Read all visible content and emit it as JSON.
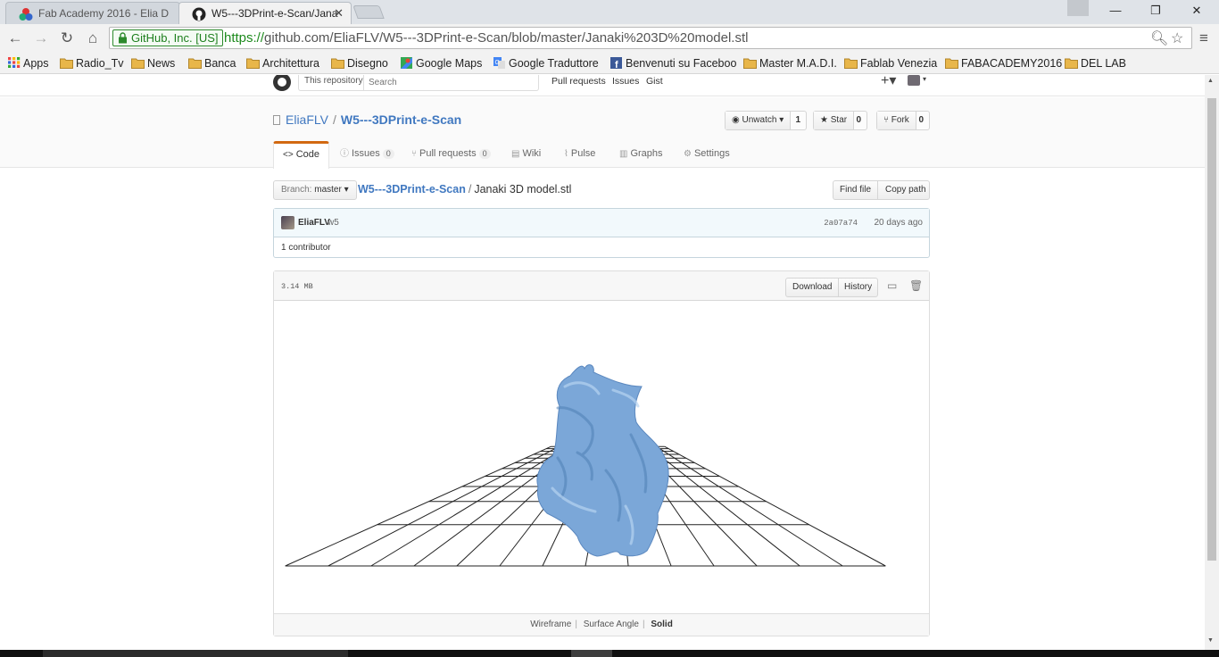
{
  "browser": {
    "tabs": [
      {
        "title": "Fab Academy 2016 - Elia D",
        "active": false,
        "favicon": "fab-academy-icon"
      },
      {
        "title": "W5---3DPrint-e-Scan/Jana",
        "active": true,
        "favicon": "github-icon"
      }
    ],
    "window_controls": {
      "minimize": "—",
      "restore": "❐",
      "close": "✕"
    },
    "address": {
      "ev_label": "GitHub, Inc. [US]",
      "scheme": "https://",
      "host_path": "github.com/EliaFLV/W5---3DPrint-e-Scan/blob/master/Janaki%203D%20model.stl"
    },
    "bookmarks": [
      {
        "label": "Apps",
        "icon": "apps-grid-icon"
      },
      {
        "label": "Radio_Tv",
        "icon": "folder-icon"
      },
      {
        "label": "News",
        "icon": "folder-icon"
      },
      {
        "label": "Banca",
        "icon": "folder-icon"
      },
      {
        "label": "Architettura",
        "icon": "folder-icon"
      },
      {
        "label": "Disegno",
        "icon": "folder-icon"
      },
      {
        "label": "Google Maps",
        "icon": "google-maps-icon"
      },
      {
        "label": "Google Traduttore",
        "icon": "google-translate-icon"
      },
      {
        "label": "Benvenuti su Faceboo",
        "icon": "facebook-icon"
      },
      {
        "label": "Master M.A.D.I.",
        "icon": "folder-icon"
      },
      {
        "label": "Fablab Venezia",
        "icon": "folder-icon"
      },
      {
        "label": "FABACADEMY2016",
        "icon": "folder-icon"
      },
      {
        "label": "DEL LAB",
        "icon": "folder-icon"
      }
    ],
    "colors": {
      "ev_green": "#1d8a1d",
      "folder": "#e8b64a"
    }
  },
  "github": {
    "header": {
      "scope_label": "This repository",
      "search_placeholder": "Search",
      "links": [
        "Pull requests",
        "Issues",
        "Gist"
      ],
      "plus": "+▾",
      "caret": "▾"
    },
    "repo": {
      "owner": "EliaFLV",
      "name": "W5---3DPrint-e-Scan",
      "watch": {
        "label": "Unwatch ▾",
        "count": "1"
      },
      "star": {
        "label": "Star",
        "count": "0"
      },
      "fork": {
        "label": "Fork",
        "count": "0"
      },
      "tabs": [
        {
          "label": "Code",
          "icon": "<>",
          "count": null
        },
        {
          "label": "Issues",
          "icon": "ⓘ",
          "count": "0"
        },
        {
          "label": "Pull requests",
          "icon": "⑂",
          "count": "0"
        },
        {
          "label": "Wiki",
          "icon": "▤",
          "count": null
        },
        {
          "label": "Pulse",
          "icon": "⌇",
          "count": null
        },
        {
          "label": "Graphs",
          "icon": "▥",
          "count": null
        },
        {
          "label": "Settings",
          "icon": "⚙",
          "count": null
        }
      ]
    },
    "file_nav": {
      "branch_label": "Branch:",
      "branch_value": "master ▾",
      "crumb_repo": "W5---3DPrint-e-Scan",
      "crumb_sep": "/",
      "crumb_file": "Janaki 3D model.stl",
      "find_file": "Find file",
      "copy_path": "Copy path"
    },
    "commit": {
      "author": "EliaFLV",
      "message": "w5",
      "sha": "2a07a74",
      "time": "20 days ago",
      "contributors": "1 contributor"
    },
    "file": {
      "size": "3.14 MB",
      "download": "Download",
      "history": "History",
      "render_modes": [
        "Wireframe",
        "Surface Angle",
        "Solid"
      ],
      "active_mode": "Solid",
      "model_color": "#7ba7d8"
    }
  }
}
